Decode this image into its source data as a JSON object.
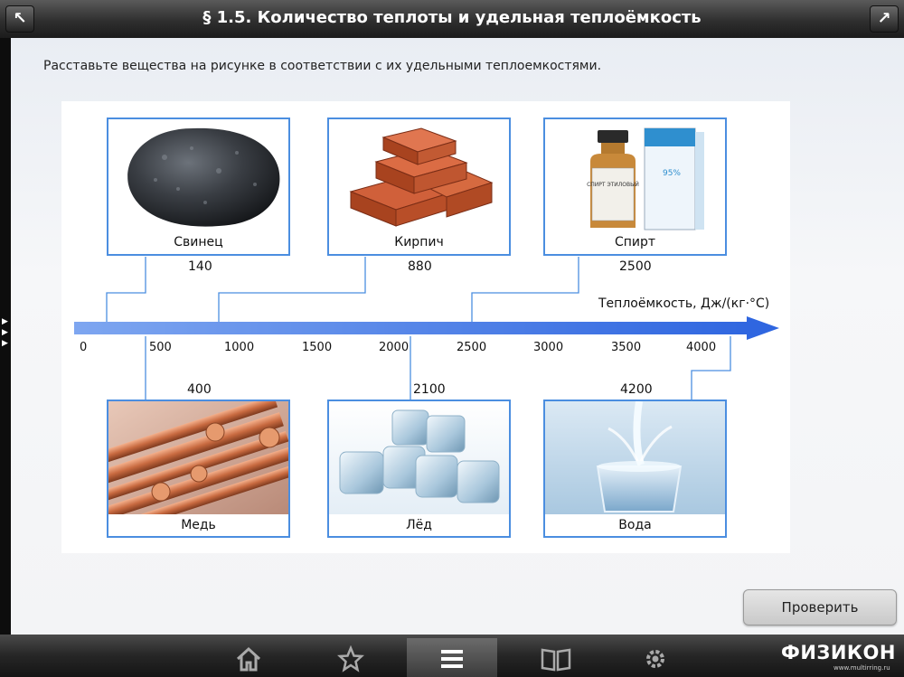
{
  "header": {
    "title": "§ 1.5. Количество теплоты и удельная теплоёмкость",
    "back_icon": "arrow-up-left-icon",
    "forward_icon": "arrow-up-right-icon"
  },
  "instruction": "Расставьте вещества на рисунке в соответствии с их удельными теплоемкостями.",
  "axis": {
    "label": "Теплоёмкость, Дж/(кг·°С)",
    "ticks": [
      "0",
      "500",
      "1000",
      "1500",
      "2000",
      "2500",
      "3000",
      "3500",
      "4000"
    ],
    "color": "#3a72e6"
  },
  "substances_top": [
    {
      "name": "Свинец",
      "value": "140",
      "image": "coal-lump"
    },
    {
      "name": "Кирпич",
      "value": "880",
      "image": "bricks"
    },
    {
      "name": "Спирт",
      "value": "2500",
      "image": "alcohol-bottle"
    }
  ],
  "substances_bottom": [
    {
      "name": "Медь",
      "value": "400",
      "image": "copper-rods"
    },
    {
      "name": "Лёд",
      "value": "2100",
      "image": "ice-cubes"
    },
    {
      "name": "Вода",
      "value": "4200",
      "image": "water-glass"
    }
  ],
  "bottle_label": "СПИРТ ЭТИЛОВЫЙ",
  "bottle_percent": "95%",
  "check_button": "Проверить",
  "footer": {
    "logo": "ФИЗИКОН",
    "url": "www.multirring.ru",
    "nav": [
      "home-icon",
      "star-icon",
      "menu-icon",
      "book-icon",
      "gear-icon"
    ]
  }
}
